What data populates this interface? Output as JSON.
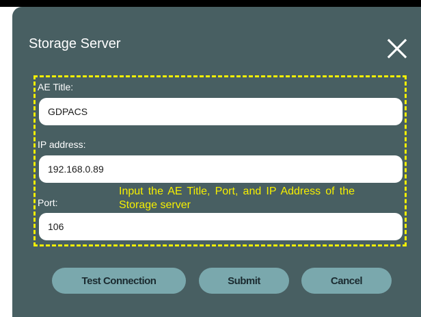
{
  "dialog": {
    "title": "Storage Server"
  },
  "form": {
    "ae_title": {
      "label": "AE Title:",
      "value": "GDPACS"
    },
    "ip_address": {
      "label": "IP address:",
      "value": "192.168.0.89"
    },
    "port": {
      "label": "Port:",
      "value": "106"
    }
  },
  "annotation": {
    "text": "Input the AE Title, Port, and IP Address of the Storage server",
    "color": "#f6f000"
  },
  "buttons": {
    "test_connection": "Test Connection",
    "submit": "Submit",
    "cancel": "Cancel"
  },
  "icons": {
    "close": "close-icon"
  },
  "colors": {
    "dialog_background": "#485f62",
    "button_background": "#7aa8ad",
    "highlight": "#f6f000"
  }
}
